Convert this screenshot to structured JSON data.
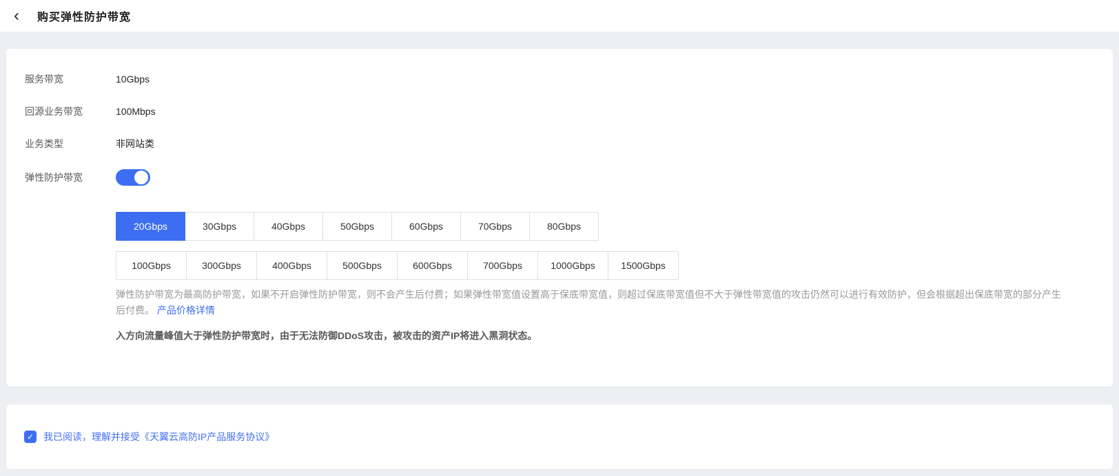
{
  "header": {
    "back_icon": "‹",
    "title": "购买弹性防护带宽"
  },
  "form": {
    "fields": [
      {
        "label": "服务带宽",
        "value": "10Gbps"
      },
      {
        "label": "回源业务带宽",
        "value": "100Mbps"
      },
      {
        "label": "业务类型",
        "value": "非网站类"
      }
    ],
    "elastic": {
      "label": "弹性防护带宽",
      "toggle_state": "on",
      "selected_option": "20Gbps",
      "options_row1": [
        "20Gbps",
        "30Gbps",
        "40Gbps",
        "50Gbps",
        "60Gbps",
        "70Gbps",
        "80Gbps"
      ],
      "options_row2": [
        "100Gbps",
        "300Gbps",
        "400Gbps",
        "500Gbps",
        "600Gbps",
        "700Gbps",
        "1000Gbps",
        "1500Gbps"
      ],
      "description": "弹性防护带宽为最高防护带宽，如果不开启弹性防护带宽，则不会产生后付费；如果弹性带宽值设置高于保底带宽值，则超过保底带宽值但不大于弹性带宽值的攻击仍然可以进行有效防护，但会根据超出保底带宽的部分产生后付费。",
      "price_link": "产品价格详情",
      "warning": "入方向流量峰值大于弹性防护带宽时，由于无法防御DDoS攻击，被攻击的资产IP将进入黑洞状态。"
    }
  },
  "agreement": {
    "checkbox_state": "checked",
    "checkbox_icon": "✓",
    "text": "我已阅读，理解并接受",
    "link": "《天翼云高防IP产品服务协议》"
  },
  "colors": {
    "accent": "#3d6ef2",
    "background": "#edeff3",
    "label_text": "#595959",
    "value_text": "#262626",
    "desc_text": "#999999",
    "border": "#dcdfe6"
  }
}
